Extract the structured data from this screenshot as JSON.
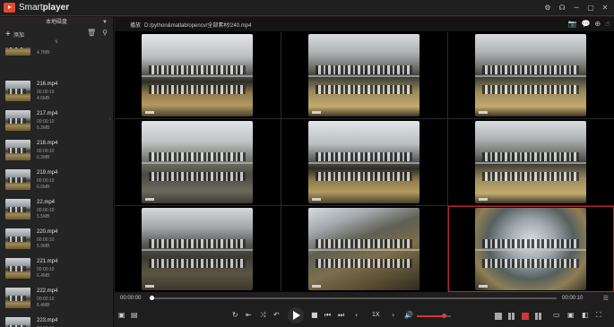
{
  "app": {
    "title_light": "Smart",
    "title_bold": "player"
  },
  "window_controls": [
    "⚙",
    "☊",
    "─",
    "▢",
    "✕"
  ],
  "sidebar": {
    "source_label": "本地磁盘",
    "add_label": "添加",
    "sort_glyph": "⇅",
    "files": [
      {
        "name": "",
        "duration": "",
        "size": "4.7MB",
        "partial": true
      },
      {
        "name": "216.mp4",
        "duration": "00:00:10",
        "size": "4.6MB"
      },
      {
        "name": "217.mp4",
        "duration": "00:00:10",
        "size": "6.2MB"
      },
      {
        "name": "218.mp4",
        "duration": "00:00:10",
        "size": "6.3MB"
      },
      {
        "name": "219.mp4",
        "duration": "00:00:10",
        "size": "6.6MB"
      },
      {
        "name": "22.mp4",
        "duration": "00:00:10",
        "size": "5.5MB"
      },
      {
        "name": "220.mp4",
        "duration": "00:00:10",
        "size": "5.9MB"
      },
      {
        "name": "221.mp4",
        "duration": "00:00:10",
        "size": "6.4MB"
      },
      {
        "name": "222.mp4",
        "duration": "00:00:10",
        "size": "6.4MB"
      },
      {
        "name": "223.mp4",
        "duration": "00:00:10",
        "size": "6.2MB"
      }
    ]
  },
  "player": {
    "status_label": "播放",
    "file_path": "D:/python&matlab/opencv/全部素材/240.mp4",
    "current_time": "00:00:00",
    "total_time": "00:00:10",
    "progress": 0.0,
    "speed": "1X",
    "volume": 0.78,
    "active_cell": 8,
    "cells": [
      {
        "scene": "barn"
      },
      {
        "scene": "barn2"
      },
      {
        "scene": "barn2"
      },
      {
        "scene": "aisle"
      },
      {
        "scene": "barn"
      },
      {
        "scene": "barn2"
      },
      {
        "scene": "pen"
      },
      {
        "scene": "mud"
      },
      {
        "scene": "fish"
      }
    ]
  },
  "colors": {
    "accent": "#d8323a",
    "active_border": "#b8262b",
    "background": "#1c1c1c"
  }
}
